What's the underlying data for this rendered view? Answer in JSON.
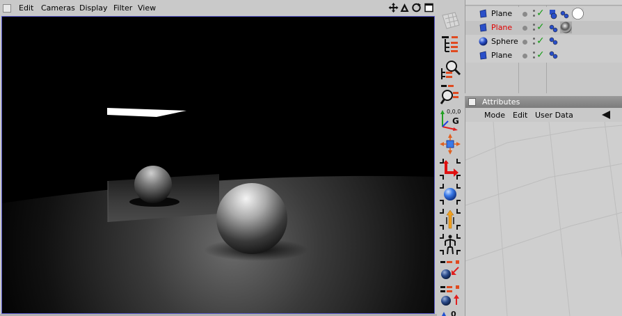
{
  "viewport": {
    "menu": [
      "Edit",
      "Cameras",
      "Display",
      "Filter",
      "View"
    ],
    "nav_icons": [
      "move-cross-icon",
      "zoom-triangle-icon",
      "rotate-circle-icon",
      "maximize-square-icon"
    ]
  },
  "toolbar": {
    "tools": [
      "hierarchy-icon",
      "search-hierarchy-icon",
      "search-object-icon",
      "coordinate-axes-icon",
      "scale-arrows-icon",
      "rotate-red-arrow-icon",
      "blue-sphere-icon",
      "figure-up-arrow-icon",
      "figure-icon",
      "sphere-link-down-icon",
      "sphere-link-up-icon"
    ]
  },
  "objects": {
    "rows": [
      {
        "name": "Plane",
        "color": "#000000",
        "icon": "plane-cube-icon",
        "tags": [
          "texture-tag-icon",
          "phong-tag-icon",
          "white-material-icon"
        ]
      },
      {
        "name": "Plane",
        "color": "#e00000",
        "icon": "plane-cube-icon",
        "tags": [
          "phong-tag-icon",
          "chrome-material-icon"
        ]
      },
      {
        "name": "Sphere",
        "color": "#000000",
        "icon": "sphere-icon",
        "tags": [
          "phong-tag-icon"
        ]
      },
      {
        "name": "Plane",
        "color": "#000000",
        "icon": "plane-cube-icon",
        "tags": [
          "phong-tag-icon"
        ]
      }
    ]
  },
  "attributes": {
    "title": "Attributes",
    "menu": [
      "Mode",
      "Edit",
      "User Data"
    ]
  },
  "colors": {
    "panel_bg": "#c8c8c8",
    "viewport_border": "#5a5acc",
    "active_object": "#e00000",
    "visibility_check": "#169c16"
  }
}
